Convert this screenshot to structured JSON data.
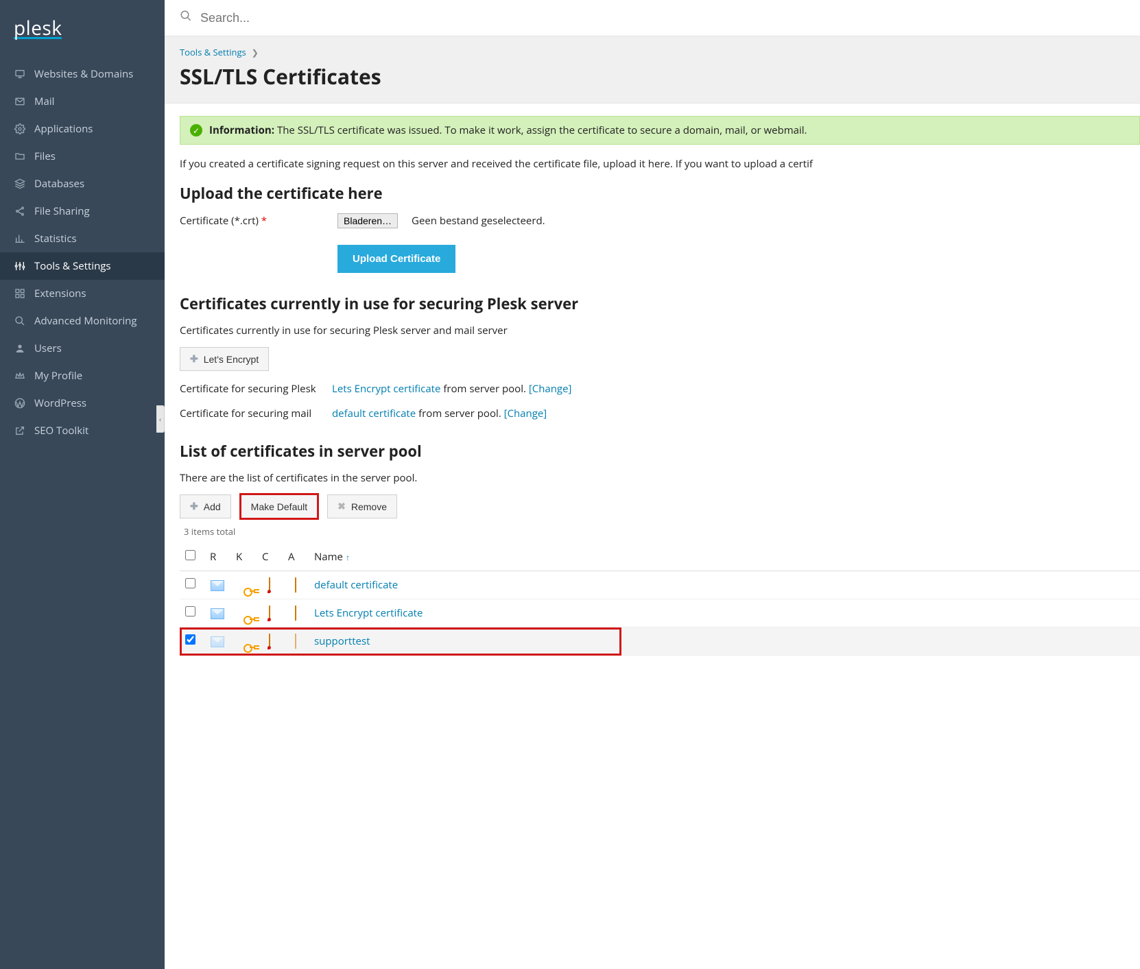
{
  "logo": "plesk",
  "search": {
    "placeholder": "Search..."
  },
  "sidebar": {
    "items": [
      {
        "label": "Websites & Domains",
        "icon": "monitor"
      },
      {
        "label": "Mail",
        "icon": "mail"
      },
      {
        "label": "Applications",
        "icon": "gear"
      },
      {
        "label": "Files",
        "icon": "folder"
      },
      {
        "label": "Databases",
        "icon": "stack"
      },
      {
        "label": "File Sharing",
        "icon": "share"
      },
      {
        "label": "Statistics",
        "icon": "chart"
      },
      {
        "label": "Tools & Settings",
        "icon": "sliders",
        "active": true
      },
      {
        "label": "Extensions",
        "icon": "grid"
      },
      {
        "label": "Advanced Monitoring",
        "icon": "magnify"
      },
      {
        "label": "Users",
        "icon": "user"
      },
      {
        "label": "My Profile",
        "icon": "crown"
      },
      {
        "label": "WordPress",
        "icon": "wp"
      },
      {
        "label": "SEO Toolkit",
        "icon": "external"
      }
    ]
  },
  "breadcrumb": {
    "parent": "Tools & Settings"
  },
  "page_title": "SSL/TLS Certificates",
  "alert": {
    "prefix": "Information:",
    "text": "The SSL/TLS certificate was issued. To make it work, assign the certificate to secure a domain, mail, or webmail."
  },
  "intro": "If you created a certificate signing request on this server and received the certificate file, upload it here. If you want to upload a certif",
  "upload": {
    "heading": "Upload the certificate here",
    "field_label": "Certificate (*.crt)",
    "browse_btn": "Bladeren…",
    "no_file": "Geen bestand geselecteerd.",
    "submit": "Upload Certificate"
  },
  "in_use": {
    "heading": "Certificates currently in use for securing Plesk server",
    "sub": "Certificates currently in use for securing Plesk server and mail server",
    "lets_encrypt_btn": "Let's Encrypt",
    "rows": [
      {
        "label": "Certificate for securing Plesk",
        "cert": "Lets Encrypt certificate",
        "suffix": "from server pool.",
        "change": "[Change]"
      },
      {
        "label": "Certificate for securing mail",
        "cert": "default certificate",
        "suffix": "from server pool.",
        "change": "[Change]"
      }
    ]
  },
  "pool": {
    "heading": "List of certificates in server pool",
    "sub": "There are the list of certificates in the server pool.",
    "toolbar": {
      "add": "Add",
      "make_default": "Make Default",
      "remove": "Remove"
    },
    "total": "3 items total",
    "columns": {
      "r": "R",
      "k": "K",
      "c": "C",
      "a": "A",
      "name": "Name"
    },
    "rows": [
      {
        "checked": false,
        "name": "default certificate",
        "r": true,
        "k": true,
        "c": true,
        "a": true,
        "a_dim": false
      },
      {
        "checked": false,
        "name": "Lets Encrypt certificate",
        "r": true,
        "k": true,
        "c": true,
        "a": true,
        "a_dim": false
      },
      {
        "checked": true,
        "name": "supporttest",
        "r": true,
        "r_dim": true,
        "k": true,
        "c": true,
        "a": true,
        "a_dim": true,
        "highlighted": true
      }
    ]
  }
}
